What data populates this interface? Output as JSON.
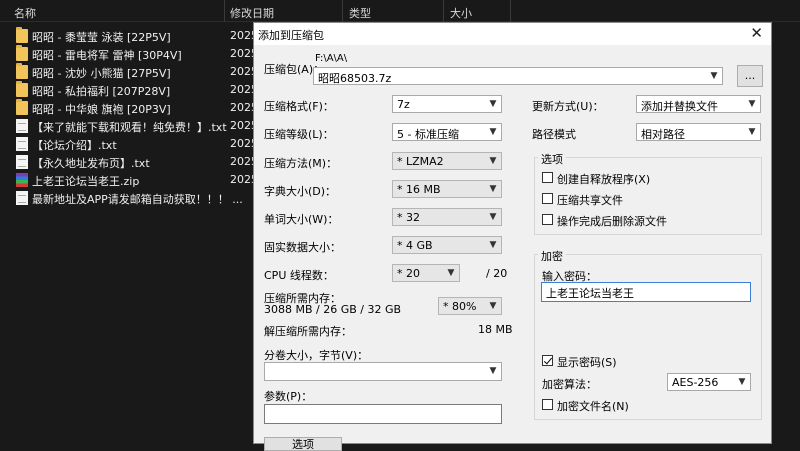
{
  "explorer": {
    "columns": [
      "名称",
      "修改日期",
      "类型",
      "大小"
    ],
    "files": [
      {
        "name": "昭昭 - 黍莹莹 泳装 [22P5V]",
        "date": "2025",
        "icon": "folder-icon"
      },
      {
        "name": "昭昭 - 雷电将军 雷神 [30P4V]",
        "date": "2025",
        "icon": "folder-icon"
      },
      {
        "name": "昭昭 - 沈妙 小熊猫 [27P5V]",
        "date": "2025",
        "icon": "folder-icon"
      },
      {
        "name": "昭昭 - 私拍福利 [207P28V]",
        "date": "2025",
        "icon": "folder-icon"
      },
      {
        "name": "昭昭 - 中华娘 旗袍 [20P3V]",
        "date": "2025",
        "icon": "folder-icon"
      },
      {
        "name": "【来了就能下载和观看！纯免费！】.txt",
        "date": "2025",
        "icon": "text-file-icon"
      },
      {
        "name": "【论坛介绍】.txt",
        "date": "2025",
        "icon": "text-file-icon"
      },
      {
        "name": "【永久地址发布页】.txt",
        "date": "2025",
        "icon": "text-file-icon"
      },
      {
        "name": "上老王论坛当老王.zip",
        "date": "2025",
        "icon": "zip-archive-icon"
      },
      {
        "name": "最新地址及APP请发邮箱自动获取！！！ ...",
        "date": "2025",
        "icon": "text-file-icon"
      }
    ]
  },
  "dialog": {
    "title": "添加到压缩包",
    "close": "✕",
    "archive_label": "压缩包(A)：",
    "archive_path": "F:\\A\\A\\",
    "archive_name": "昭昭68503.7z",
    "browse_label": "...",
    "format_label": "压缩格式(F)：",
    "format_value": "7z",
    "level_label": "压缩等级(L)：",
    "level_value": "5 - 标准压缩",
    "method_label": "压缩方法(M)：",
    "method_value": "* LZMA2",
    "dict_label": "字典大小(D)：",
    "dict_value": "* 16 MB",
    "word_label": "单词大小(W)：",
    "word_value": "* 32",
    "solid_label": "固实数据大小：",
    "solid_value": "* 4 GB",
    "threads_label": "CPU 线程数：",
    "threads_value": "* 20",
    "threads_max": "/ 20",
    "mem_label": "压缩所需内存：",
    "mem_values": "3088 MB / 26 GB / 32 GB",
    "mem_percent": "* 80%",
    "decomp_label": "解压缩所需内存：",
    "decomp_value": "18 MB",
    "split_label": "分卷大小，字节(V)：",
    "params_label": "参数(P)：",
    "options_button": "选项",
    "update_label": "更新方式(U)：",
    "update_value": "添加并替换文件",
    "path_label": "路径模式",
    "path_value": "相对路径",
    "options_group": "选项",
    "opt_sfx": "创建自释放程序(X)",
    "opt_shared": "压缩共享文件",
    "opt_delete": "操作完成后删除源文件",
    "encrypt_group": "加密",
    "pwd_label": "输入密码：",
    "pwd_value": "上老王论坛当老王",
    "show_pwd": "显示密码(S)",
    "enc_method_label": "加密算法：",
    "enc_method_value": "AES-256",
    "enc_names": "加密文件名(N)"
  }
}
